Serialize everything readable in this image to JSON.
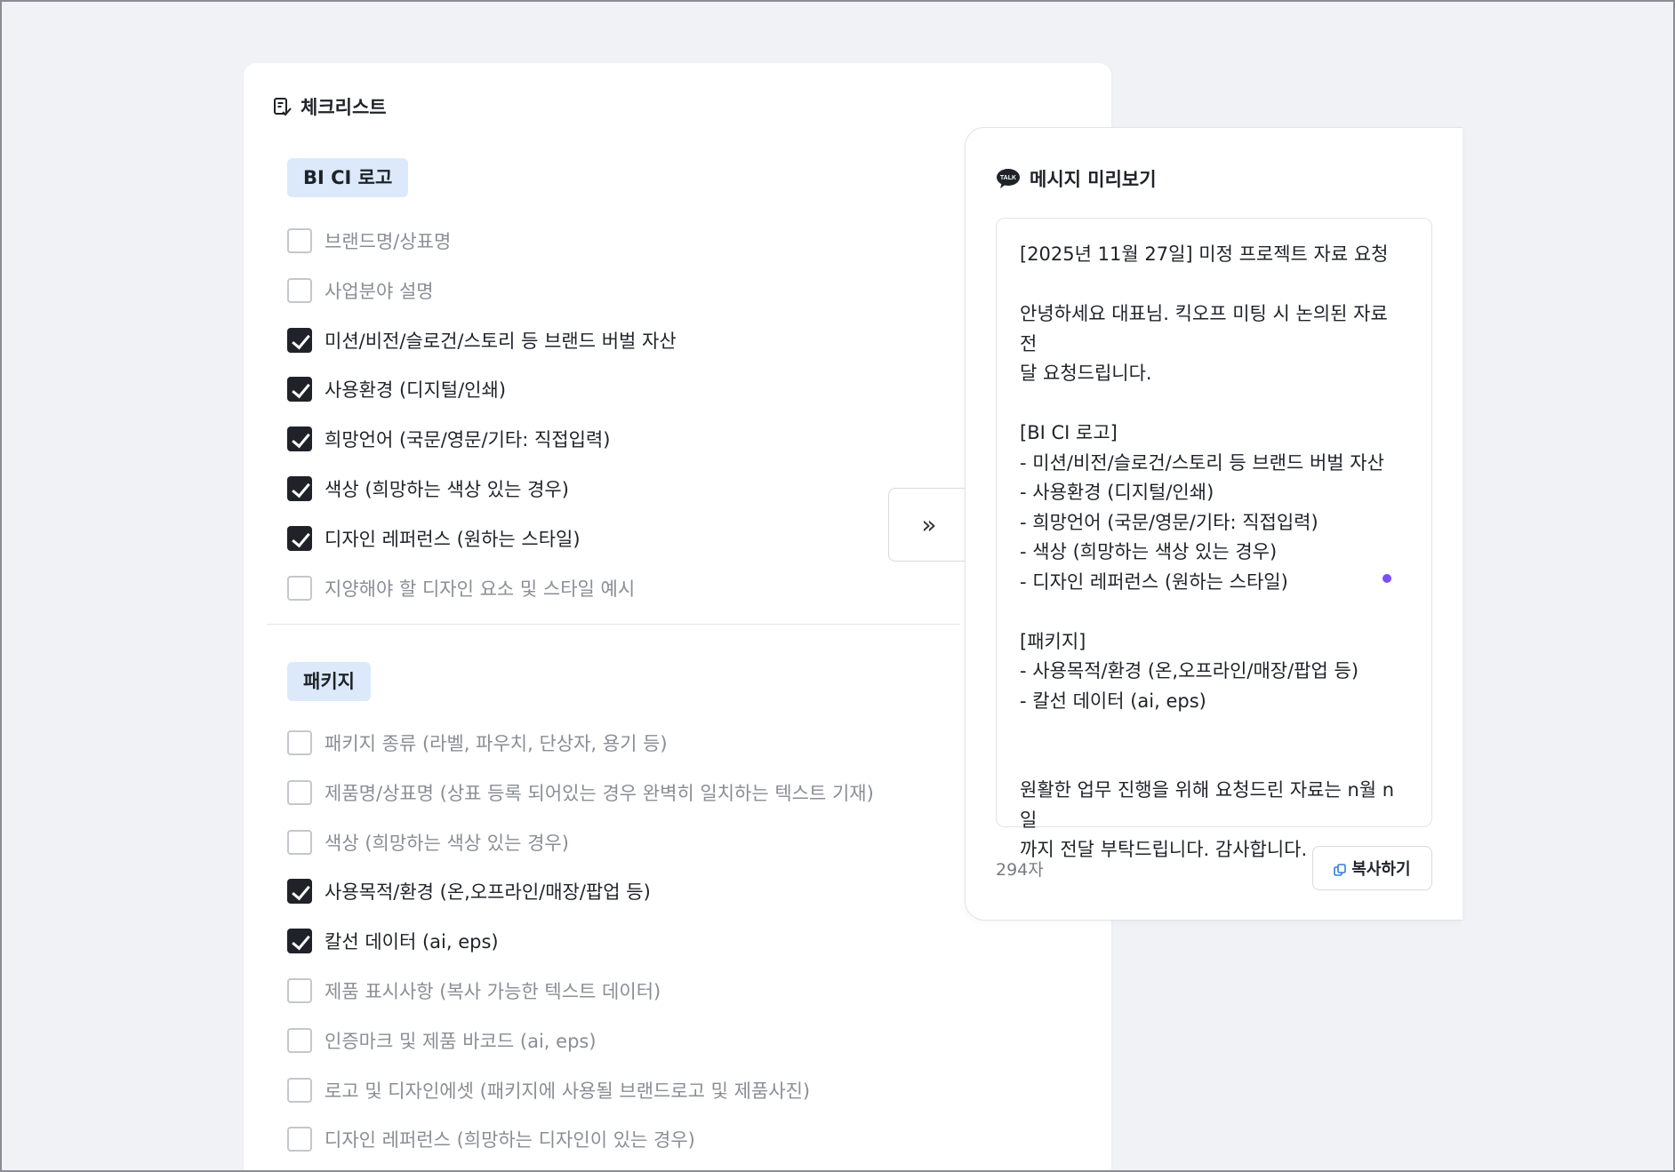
{
  "checklist": {
    "title": "체크리스트",
    "sections": [
      {
        "tag": "BI CI 로고",
        "items": [
          {
            "label": "브랜드명/상표명",
            "checked": false
          },
          {
            "label": "사업분야 설명",
            "checked": false
          },
          {
            "label": "미션/비전/슬로건/스토리 등 브랜드 버벌 자산",
            "checked": true
          },
          {
            "label": "사용환경 (디지털/인쇄)",
            "checked": true
          },
          {
            "label": "희망언어 (국문/영문/기타: 직접입력)",
            "checked": true
          },
          {
            "label": "색상 (희망하는 색상 있는 경우)",
            "checked": true
          },
          {
            "label": "디자인 레퍼런스 (원하는 스타일)",
            "checked": true
          },
          {
            "label": "지양해야 할 디자인 요소 및 스타일 예시",
            "checked": false
          }
        ]
      },
      {
        "tag": "패키지",
        "items": [
          {
            "label": "패키지 종류 (라벨, 파우치, 단상자, 용기 등)",
            "checked": false
          },
          {
            "label": "제품명/상표명 (상표 등록 되어있는 경우 완벽히 일치하는 텍스트 기재)",
            "checked": false
          },
          {
            "label": "색상 (희망하는 색상 있는 경우)",
            "checked": false
          },
          {
            "label": "사용목적/환경 (온,오프라인/매장/팝업 등)",
            "checked": true
          },
          {
            "label": "칼선 데이터 (ai, eps)",
            "checked": true
          },
          {
            "label": "제품 표시사항 (복사 가능한 텍스트 데이터)",
            "checked": false
          },
          {
            "label": "인증마크 및 제품 바코드 (ai, eps)",
            "checked": false
          },
          {
            "label": "로고 및 디자인에셋 (패키지에 사용될 브랜드로고 및 제품사진)",
            "checked": false
          },
          {
            "label": "디자인 레퍼런스 (희망하는 디자인이 있는 경우)",
            "checked": false
          }
        ]
      }
    ]
  },
  "transfer_button": {
    "label": "»",
    "icon": "double-chevron-right-icon"
  },
  "preview": {
    "title": "메시지 미리보기",
    "icon": "kakao-talk-icon",
    "lines": [
      "[2025년 11월 27일] 미정 프로젝트 자료 요청",
      "",
      "안녕하세요 대표님. 킥오프 미팅 시 논의된 자료 전",
      "달 요청드립니다.",
      "",
      "[BI CI 로고]",
      "- 미션/비전/슬로건/스토리 등 브랜드 버벌 자산",
      "- 사용환경 (디지털/인쇄)",
      "- 희망언어 (국문/영문/기타: 직접입력)",
      "- 색상 (희망하는 색상 있는 경우)",
      "- 디자인 레퍼런스 (원하는 스타일)",
      "",
      "[패키지]",
      "- 사용목적/환경 (온,오프라인/매장/팝업 등)",
      "- 칼선 데이터 (ai, eps)",
      "",
      "",
      "원활한 업무 진행을 위해 요청드린 자료는 n월 n일",
      "까지 전달 부탁드립니다. 감사합니다."
    ],
    "char_count": "294자",
    "copy_label": "복사하기"
  },
  "colors": {
    "accent_tag": "#dbe9fa",
    "checked": "#1f2329",
    "typing_dot": "#7c4dff"
  }
}
